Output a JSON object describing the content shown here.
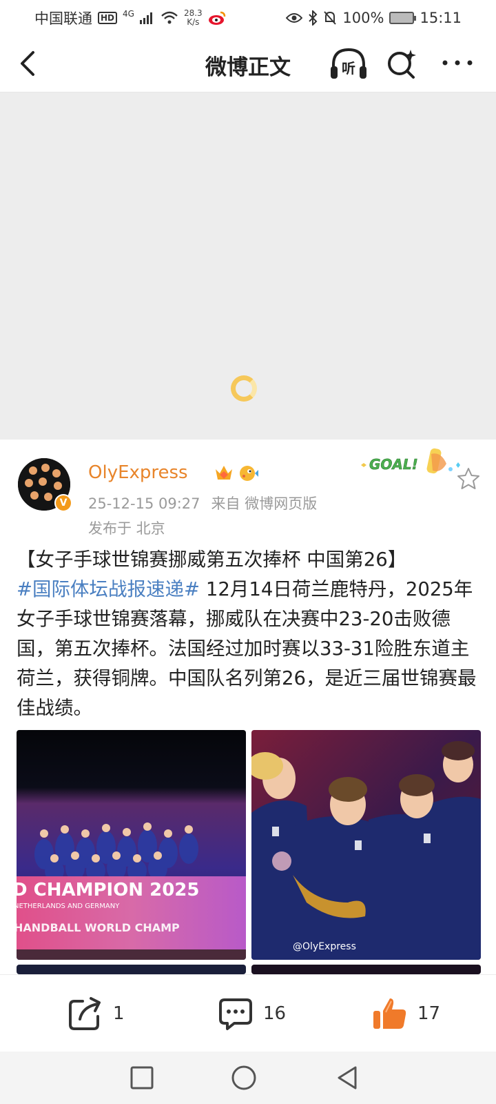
{
  "status_bar": {
    "carrier": "中国联通",
    "hd": "HD",
    "network": "4G",
    "speed_value": "28.3",
    "speed_unit": "K/s",
    "battery": "100%",
    "time": "15:11"
  },
  "header": {
    "title": "微博正文",
    "listen_label": "听"
  },
  "author": {
    "name": "OlyExpress",
    "verified_mark": "V",
    "timestamp": "25-12-15 09:27",
    "source": "来自 微博网页版",
    "location": "发布于 北京",
    "sticker_text": "GOAL!"
  },
  "post": {
    "title": "【女子手球世锦赛挪威第五次捧杯 中国第26】",
    "hashtag": "#国际体坛战报速递#",
    "body": " 12月14日荷兰鹿特丹，2025年女子手球世锦赛落幕，挪威队在决赛中23-20击败德国，第五次捧杯。法国经过加时赛以33-31险胜东道主荷兰，获得铜牌。中国队名列第26，是近三届世锦赛最佳战绩。"
  },
  "photos": {
    "photo1_banner_line1": "D CHAMPION 2025",
    "photo1_banner_line2": "NETHERLANDS AND GERMANY",
    "photo1_banner_line3": "HANDBALL WORLD CHAMP",
    "photo2_watermark": "@OlyExpress"
  },
  "actions": {
    "repost_count": "1",
    "comment_count": "16",
    "like_count": "17"
  },
  "colors": {
    "accent_orange": "#e8852b",
    "hashtag_blue": "#4a7fc1",
    "like_orange": "#f07a2a"
  }
}
